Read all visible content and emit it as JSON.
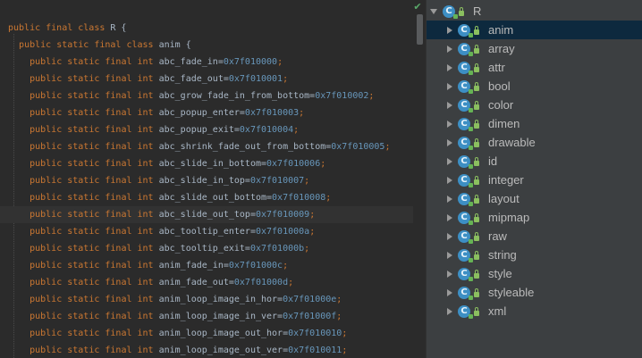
{
  "editor": {
    "lines": [
      {
        "indent": 0,
        "decl": "public final class ",
        "name": "R {",
        "num": "",
        "tail": ""
      },
      {
        "indent": 1,
        "decl": "public static final class ",
        "name": "anim {",
        "num": "",
        "tail": ""
      },
      {
        "indent": 2,
        "decl": "public static final int ",
        "name": "abc_fade_in=",
        "num": "0x7f010000",
        "tail": ";"
      },
      {
        "indent": 2,
        "decl": "public static final int ",
        "name": "abc_fade_out=",
        "num": "0x7f010001",
        "tail": ";"
      },
      {
        "indent": 2,
        "decl": "public static final int ",
        "name": "abc_grow_fade_in_from_bottom=",
        "num": "0x7f010002",
        "tail": ";"
      },
      {
        "indent": 2,
        "decl": "public static final int ",
        "name": "abc_popup_enter=",
        "num": "0x7f010003",
        "tail": ";"
      },
      {
        "indent": 2,
        "decl": "public static final int ",
        "name": "abc_popup_exit=",
        "num": "0x7f010004",
        "tail": ";"
      },
      {
        "indent": 2,
        "decl": "public static final int ",
        "name": "abc_shrink_fade_out_from_bottom=",
        "num": "0x7f010005",
        "tail": ";"
      },
      {
        "indent": 2,
        "decl": "public static final int ",
        "name": "abc_slide_in_bottom=",
        "num": "0x7f010006",
        "tail": ";"
      },
      {
        "indent": 2,
        "decl": "public static final int ",
        "name": "abc_slide_in_top=",
        "num": "0x7f010007",
        "tail": ";"
      },
      {
        "indent": 2,
        "decl": "public static final int ",
        "name": "abc_slide_out_bottom=",
        "num": "0x7f010008",
        "tail": ";"
      },
      {
        "indent": 2,
        "decl": "public static final int ",
        "name": "abc_slide_out_top=",
        "num": "0x7f010009",
        "tail": ";",
        "current": true
      },
      {
        "indent": 2,
        "decl": "public static final int ",
        "name": "abc_tooltip_enter=",
        "num": "0x7f01000a",
        "tail": ";"
      },
      {
        "indent": 2,
        "decl": "public static final int ",
        "name": "abc_tooltip_exit=",
        "num": "0x7f01000b",
        "tail": ";"
      },
      {
        "indent": 2,
        "decl": "public static final int ",
        "name": "anim_fade_in=",
        "num": "0x7f01000c",
        "tail": ";"
      },
      {
        "indent": 2,
        "decl": "public static final int ",
        "name": "anim_fade_out=",
        "num": "0x7f01000d",
        "tail": ";"
      },
      {
        "indent": 2,
        "decl": "public static final int ",
        "name": "anim_loop_image_in_hor=",
        "num": "0x7f01000e",
        "tail": ";"
      },
      {
        "indent": 2,
        "decl": "public static final int ",
        "name": "anim_loop_image_in_ver=",
        "num": "0x7f01000f",
        "tail": ";"
      },
      {
        "indent": 2,
        "decl": "public static final int ",
        "name": "anim_loop_image_out_hor=",
        "num": "0x7f010010",
        "tail": ";"
      },
      {
        "indent": 2,
        "decl": "public static final int ",
        "name": "anim_loop_image_out_ver=",
        "num": "0x7f010011",
        "tail": ";"
      }
    ],
    "status_icon": "check-icon"
  },
  "tree": {
    "root": {
      "label": "R",
      "icon_letter": "C",
      "expanded": true
    },
    "items": [
      {
        "label": "anim",
        "selected": true
      },
      {
        "label": "array"
      },
      {
        "label": "attr"
      },
      {
        "label": "bool"
      },
      {
        "label": "color"
      },
      {
        "label": "dimen"
      },
      {
        "label": "drawable"
      },
      {
        "label": "id"
      },
      {
        "label": "integer"
      },
      {
        "label": "layout"
      },
      {
        "label": "mipmap"
      },
      {
        "label": "raw"
      },
      {
        "label": "string"
      },
      {
        "label": "style"
      },
      {
        "label": "styleable"
      },
      {
        "label": "xml"
      }
    ]
  },
  "colors": {
    "keyword": "#cc7832",
    "number": "#6897bb",
    "text": "#a9b7c6",
    "class_icon": "#3d8fc4",
    "selection": "#0d293e"
  }
}
